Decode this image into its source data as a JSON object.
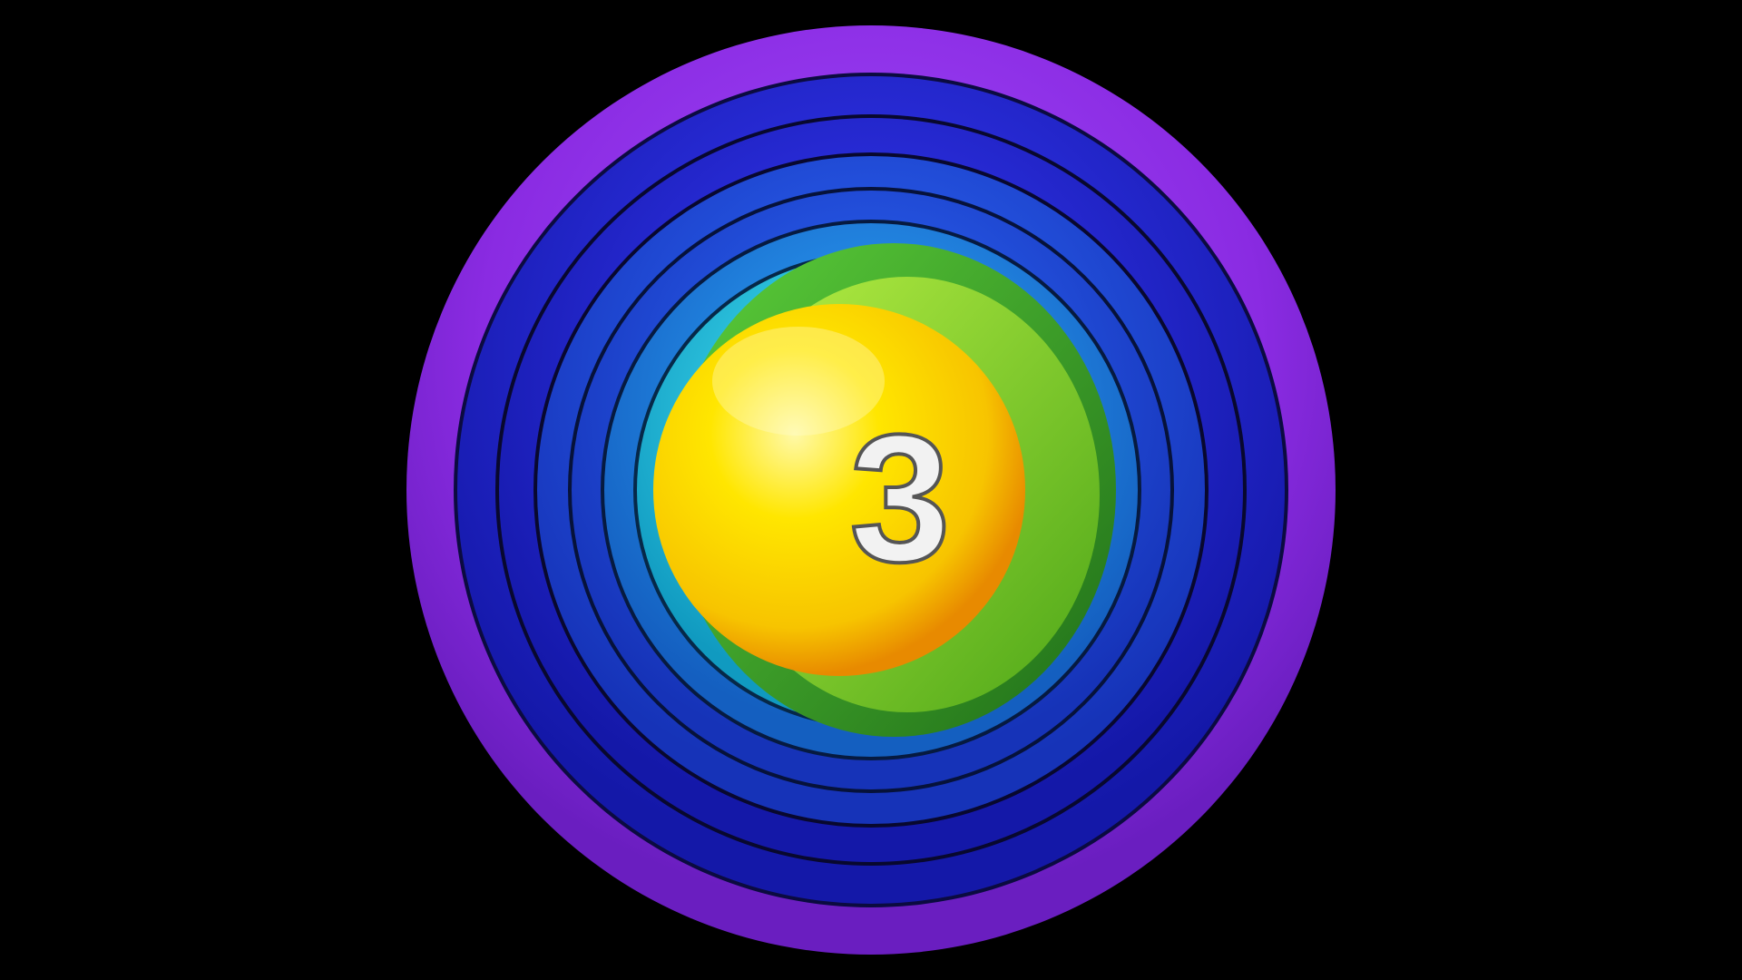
{
  "scene": {
    "type": "countdown-graphic",
    "background_color": "#000000",
    "counter_digit": "3",
    "digit_fill": "#f2f2f2",
    "digit_outline": "#555555",
    "ring_colors": {
      "outer": "#8a2be2",
      "deep_blue": "#1f2ad6",
      "blue": "#1f5fe0",
      "sky": "#1a90e8",
      "cyan": "#22c8e8",
      "green": "#3fae2a",
      "lime": "#8fd12a"
    },
    "ball_colors": {
      "highlight": "#fff36b",
      "body": "#ffe600",
      "edge": "#f29a00"
    }
  }
}
